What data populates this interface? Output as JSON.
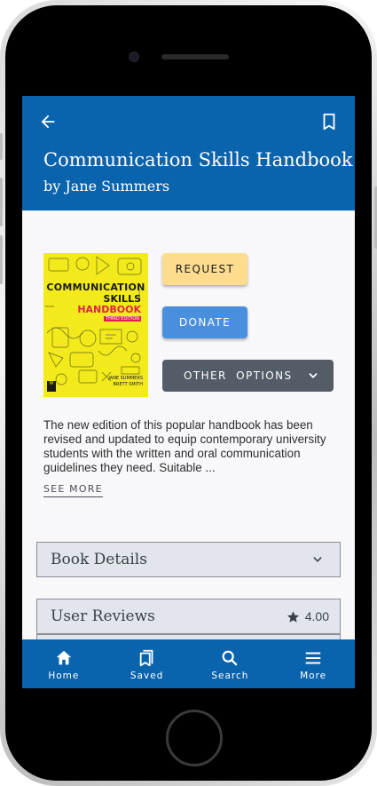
{
  "header": {
    "title": "Communication Skills Handbook",
    "author": "by Jane Summers"
  },
  "book": {
    "cover": {
      "line1": "COMMUNICATION",
      "line2": "SKILLS",
      "line3": "HANDBOOK",
      "edition": "THIRD EDITION",
      "authors_line1": "JANE SUMMERS",
      "authors_line2": "BRETT SMITH",
      "publisher_logo": "W"
    },
    "description": "The new edition of this popular handbook has been revised and updated to equip contemporary university students with the written and oral communication guidelines they need. Suitable ...",
    "see_more": "SEE MORE"
  },
  "actions": {
    "request": "REQUEST",
    "donate": "DONATE",
    "other": "OTHER  OPTIONS"
  },
  "sections": {
    "details": "Book Details",
    "reviews": "User Reviews",
    "rating": "4.00"
  },
  "tabs": [
    {
      "label": "Home",
      "icon": "home-icon"
    },
    {
      "label": "Saved",
      "icon": "saved-icon"
    },
    {
      "label": "Search",
      "icon": "search-icon"
    },
    {
      "label": "More",
      "icon": "menu-icon"
    }
  ],
  "colors": {
    "primary": "#0a63ad",
    "request": "#fddc8e",
    "donate": "#4a8fde",
    "other": "#545c68",
    "cover": "#f2ea1a"
  }
}
